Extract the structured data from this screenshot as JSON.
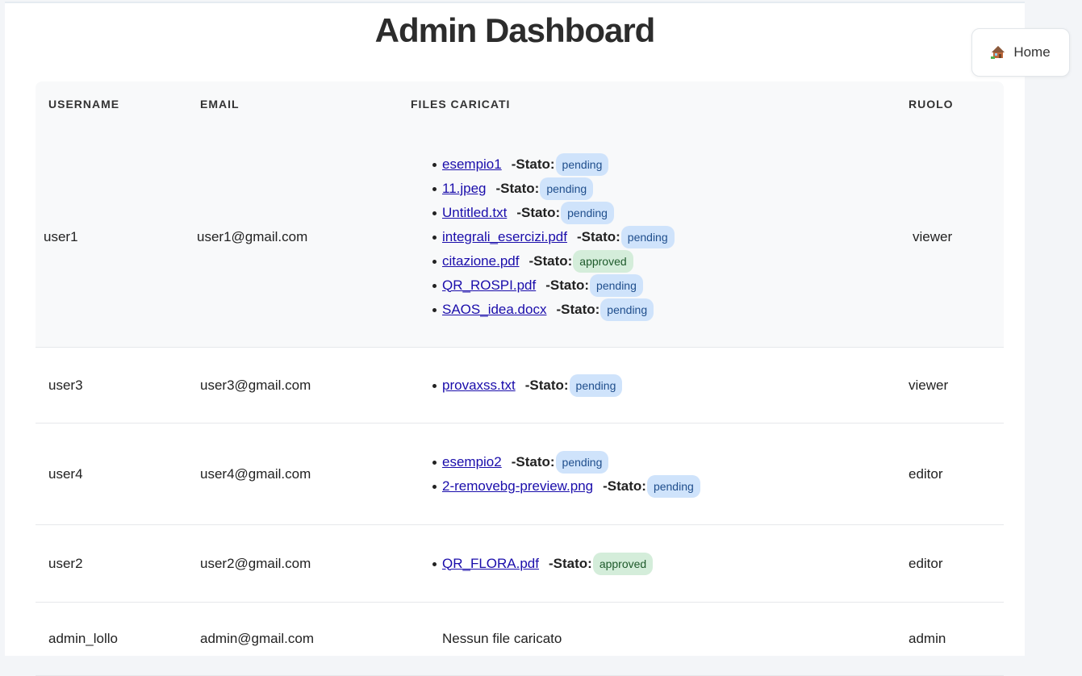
{
  "page": {
    "title": "Admin Dashboard",
    "home_label": "Home",
    "home_icon": "house-icon"
  },
  "table": {
    "headers": [
      "USERNAME",
      "EMAIL",
      "FILES CARICATI",
      "RUOLO"
    ],
    "stato_label": "-Stato:",
    "rows": [
      {
        "username": "user1",
        "email": "user1@gmail.com",
        "role": "viewer",
        "files": [
          {
            "name": "esempio1",
            "status": "pending"
          },
          {
            "name": "11.jpeg",
            "status": "pending"
          },
          {
            "name": "Untitled.txt",
            "status": "pending"
          },
          {
            "name": "integrali_esercizi.pdf",
            "status": "pending"
          },
          {
            "name": "citazione.pdf",
            "status": "approved"
          },
          {
            "name": "QR_ROSPI.pdf",
            "status": "pending"
          },
          {
            "name": "SAOS_idea.docx",
            "status": "pending"
          }
        ]
      },
      {
        "username": "user3",
        "email": "user3@gmail.com",
        "role": "viewer",
        "files": [
          {
            "name": "provaxss.txt",
            "status": "pending"
          }
        ]
      },
      {
        "username": "user4",
        "email": "user4@gmail.com",
        "role": "editor",
        "files": [
          {
            "name": "esempio2",
            "status": "pending"
          },
          {
            "name": "2-removebg-preview.png",
            "status": "pending"
          }
        ]
      },
      {
        "username": "user2",
        "email": "user2@gmail.com",
        "role": "editor",
        "files": [
          {
            "name": "QR_FLORA.pdf",
            "status": "approved"
          }
        ]
      },
      {
        "username": "admin_lollo",
        "email": "admin@gmail.com",
        "role": "admin",
        "files": [],
        "no_files_text": "Nessun file caricato"
      }
    ]
  },
  "colors": {
    "pending_bg": "#cfe3fb",
    "approved_bg": "#d4edda",
    "link": "#1a0dab"
  }
}
